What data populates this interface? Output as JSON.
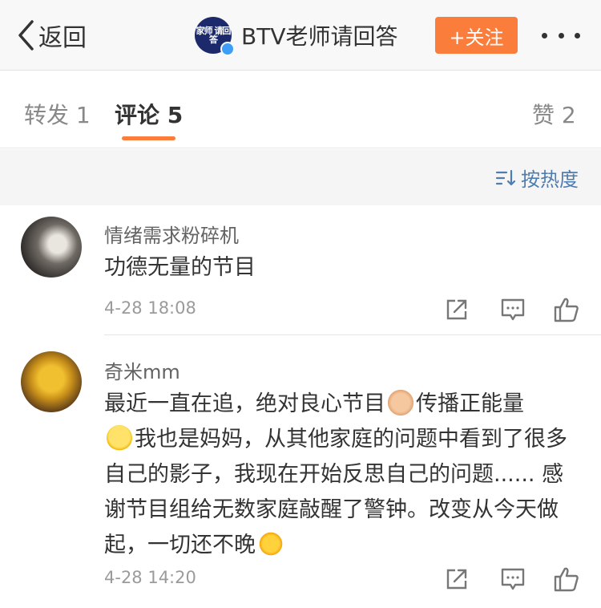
{
  "nav": {
    "back_label": "返回",
    "avatar_logo_text": "家师 请回答",
    "title": "BTV老师请回答",
    "follow_label": "+关注",
    "more_icon": "more-dots-icon"
  },
  "tabs": {
    "repost": "转发 1",
    "comment": "评论 5",
    "like": "赞 2",
    "active": "comment",
    "accent_color": "#fa7d3c"
  },
  "sort": {
    "label": "按热度",
    "icon": "sort-icon",
    "color": "#507daf"
  },
  "comments": [
    {
      "user": "情绪需求粉碎机",
      "text": "功德无量的节目",
      "time": "4-28 18:08",
      "actions": [
        "repost-icon",
        "reply-icon",
        "like-icon"
      ]
    },
    {
      "user": "奇米mm",
      "text_parts": {
        "p1": "最近一直在追，绝对良心节目",
        "emoji1": "thumbs-up-emoji",
        "p2": "传播正能量",
        "emoji2": "smile-emoji",
        "p3": "我也是妈妈，从其他家庭的问题中看到了很多自己的影子，我现在开始反思自己的问题...... 感谢节目组给无数家庭敲醒了警钟。改变从今天做起，一切还不晚",
        "emoji3": "sun-emoji"
      },
      "time": "4-28 14:20",
      "actions": [
        "repost-icon",
        "reply-icon",
        "like-icon"
      ]
    }
  ]
}
